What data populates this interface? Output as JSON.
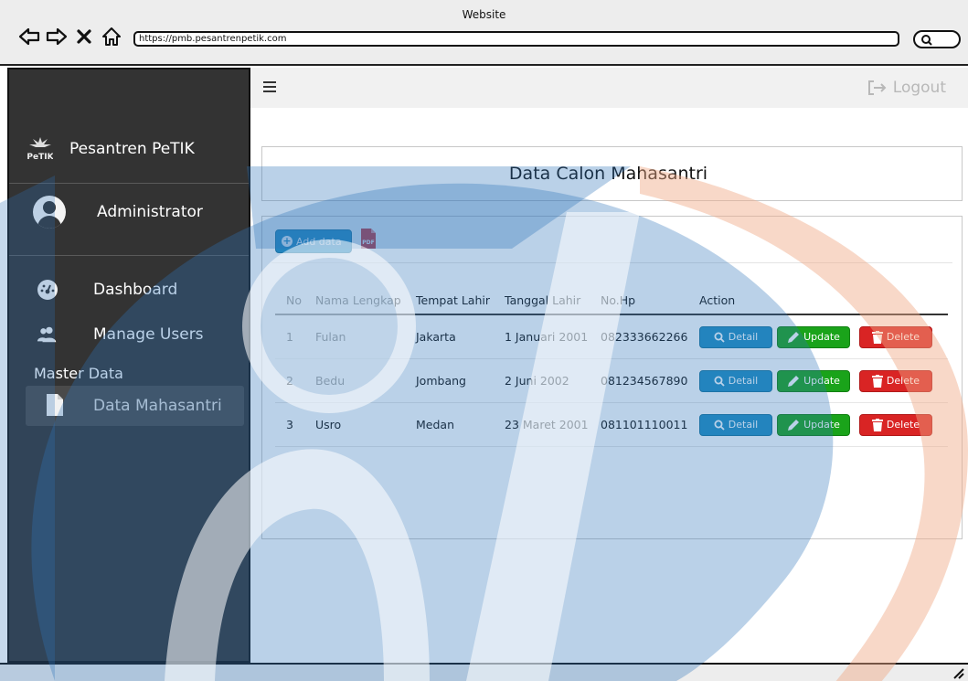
{
  "browser": {
    "window_title": "Website",
    "url": "https://pmb.pesantrenpetik.com"
  },
  "sidebar": {
    "brand_name": "Pesantren PeTIK",
    "logo_text": "PeTIK",
    "user_name": "Administrator",
    "menu": [
      {
        "label": "Dashboard",
        "icon": "dashboard-icon"
      },
      {
        "label": "Manage Users",
        "icon": "users-icon"
      }
    ],
    "section_label": "Master Data",
    "active_item": {
      "label": "Data Mahasantri",
      "icon": "file-icon"
    }
  },
  "topbar": {
    "logout_label": "Logout"
  },
  "main": {
    "page_title": "Data Calon Mahasantri",
    "add_button_label": "Add data",
    "pdf_label": "PDF",
    "table": {
      "headers": [
        "No",
        "Nama Lengkap",
        "Tempat Lahir",
        "Tanggal Lahir",
        "No.Hp",
        "Action"
      ],
      "rows": [
        {
          "no": "1",
          "nama": "Fulan",
          "tempat": "Jakarta",
          "tanggal": "1 Januari 2001",
          "hp": "082333662266"
        },
        {
          "no": "2",
          "nama": "Bedu",
          "tempat": "Jombang",
          "tanggal": "2 Juni 2002",
          "hp": "081234567890"
        },
        {
          "no": "3",
          "nama": "Usro",
          "tempat": "Medan",
          "tanggal": "23 Maret 2001",
          "hp": "081101110011"
        }
      ],
      "actions": {
        "detail": "Detail",
        "update": "Update",
        "delete": "Delete"
      }
    }
  },
  "colors": {
    "sidebar_bg": "#333333",
    "primary": "#1e8cc0",
    "success": "#1aa31a",
    "danger": "#d92424",
    "watermark_blue": "#2f74b9",
    "watermark_orange": "#f0a884"
  }
}
